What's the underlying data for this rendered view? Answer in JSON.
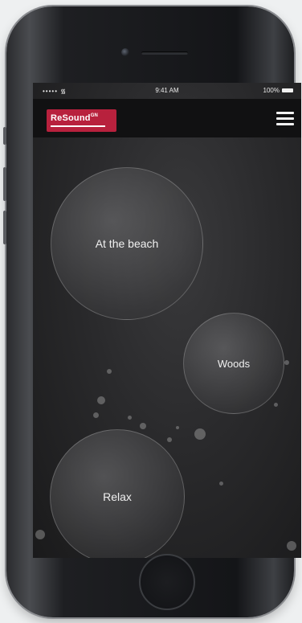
{
  "status_bar": {
    "carrier": "•••••",
    "time": "9:41 AM",
    "battery": "100%"
  },
  "header": {
    "logo": "ReSound",
    "logo_mark": "GN"
  },
  "sound_scenes": [
    {
      "label": "At the beach"
    },
    {
      "label": "Woods"
    },
    {
      "label": "Relax"
    }
  ],
  "colors": {
    "brand_red": "#b8213d",
    "screen_bg": "#2a2a2c",
    "navbar_bg": "#111112"
  },
  "icons": {
    "menu": "hamburger-menu-icon",
    "wifi": "wifi-icon",
    "battery": "battery-icon"
  }
}
